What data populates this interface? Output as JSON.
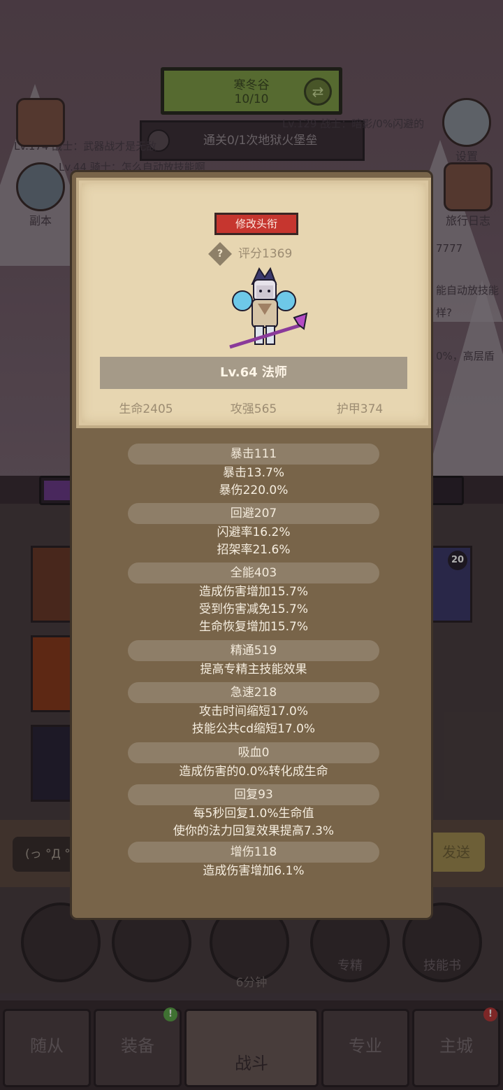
{
  "background": {
    "location_name": "寒冬谷",
    "location_progress": "10/10",
    "quest_text": "通关0/1次地狱火堡垒",
    "chat_lines": [
      "Lv.174 战士：武器战才是无敌",
      "Lv.44 骑士：怎么自动放技能啊",
      "Lv.129 战士：暗影/0%闪避的",
      "7777",
      "能自动放技能",
      "样?",
      "0%，高层盾"
    ],
    "side_icons": {
      "left_top": "",
      "left_mid": "副本",
      "right_top": "设置",
      "right_mid": "旅行日志"
    },
    "chat_input_placeholder": "(っ °Д °",
    "chat_send": "发送",
    "slot_badge": "20",
    "circle_buttons": [
      "",
      "",
      "",
      "专精",
      "技能书"
    ],
    "chest_timer": "6分钟",
    "tabs": [
      "随从",
      "装备",
      "战斗",
      "专业",
      "主城"
    ]
  },
  "card": {
    "rename_button": "修改头衔",
    "score": "评分1369",
    "level_title": "Lv.64 法师",
    "main_stats": {
      "hp": "生命2405",
      "attack": "攻强565",
      "armor": "护甲374"
    }
  },
  "stats": [
    {
      "header": "暴击111",
      "lines": [
        "暴击13.7%",
        "暴伤220.0%"
      ]
    },
    {
      "header": "回避207",
      "lines": [
        "闪避率16.2%",
        "招架率21.6%"
      ]
    },
    {
      "header": "全能403",
      "lines": [
        "造成伤害增加15.7%",
        "受到伤害减免15.7%",
        "生命恢复增加15.7%"
      ]
    },
    {
      "header": "精通519",
      "lines": [
        "提高专精主技能效果"
      ]
    },
    {
      "header": "急速218",
      "lines": [
        "攻击时间缩短17.0%",
        "技能公共cd缩短17.0%"
      ]
    },
    {
      "header": "吸血0",
      "lines": [
        "造成伤害的0.0%转化成生命"
      ]
    },
    {
      "header": "回复93",
      "lines": [
        "每5秒回复1.0%生命值",
        "使你的法力回复效果提高7.3%"
      ]
    },
    {
      "header": "增伤118",
      "lines": [
        "造成伤害增加6.1%"
      ]
    }
  ]
}
